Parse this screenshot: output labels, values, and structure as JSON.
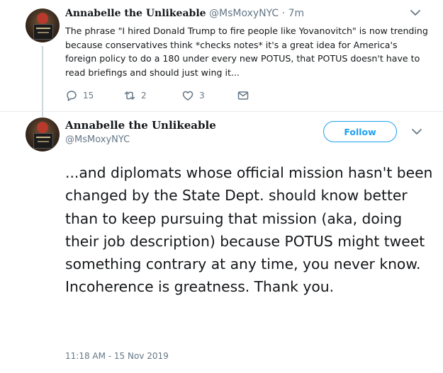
{
  "tweet1": {
    "display_name": "Annabelle the Unlikeable",
    "handle": "@MsMoxyNYC",
    "separator": "·",
    "time": "7m",
    "text": "The phrase \"I hired Donald Trump to fire people like Yovanovitch\" is now trending because conservatives think *checks notes*  it's a great idea for America's foreign policy to do a 180 under every new POTUS, that POTUS doesn't have to read briefings and should just wing it...",
    "replies": "15",
    "retweets": "2",
    "likes": "3"
  },
  "tweet2": {
    "display_name": "Annabelle the Unlikeable",
    "handle": "@MsMoxyNYC",
    "follow_label": "Follow",
    "text": "...and diplomats whose official mission hasn't been changed by the State Dept. should know better than to keep pursuing that mission (aka, doing their job description) because POTUS might tweet something contrary at any time, you never know. Incoherence is greatness. Thank you.",
    "timestamp": "11:18 AM - 15 Nov 2019"
  },
  "colors": {
    "accent": "#1da1f2",
    "secondary_text": "#657786",
    "primary_text": "#14171a"
  },
  "icons": [
    "chevron-down-icon",
    "reply-icon",
    "retweet-icon",
    "heart-icon",
    "mail-icon"
  ]
}
